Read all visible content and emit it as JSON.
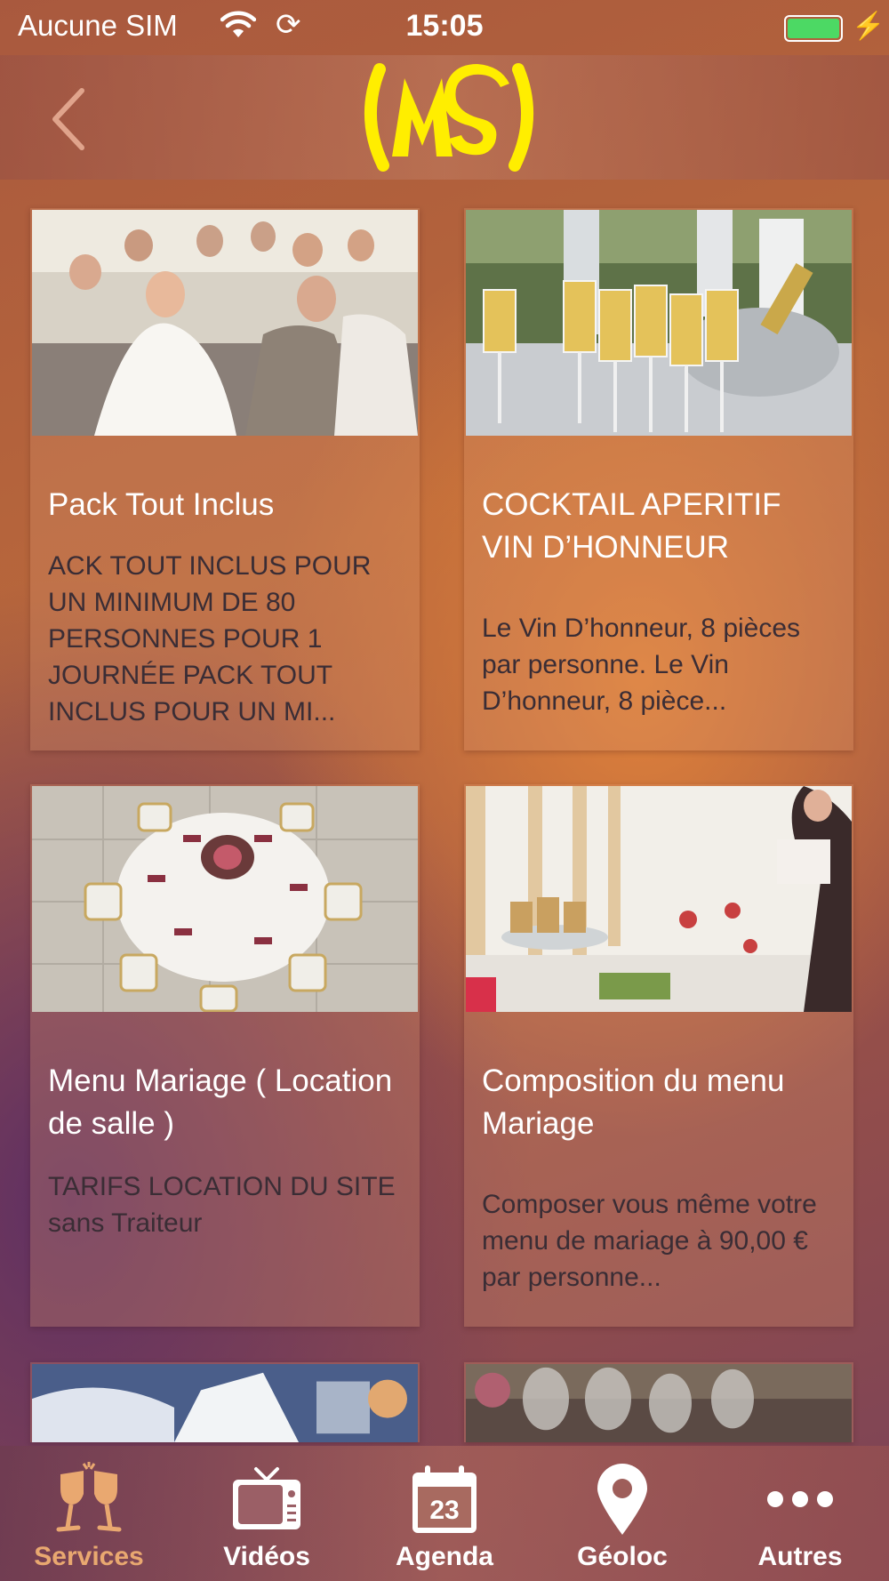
{
  "status_bar": {
    "carrier": "Aucune SIM",
    "time": "15:05",
    "icons": [
      "wifi-icon",
      "sync-icon",
      "battery-icon",
      "charging-icon"
    ]
  },
  "nav": {
    "back_icon": "chevron-left-icon",
    "logo_text": "MS",
    "logo_color": "#ffee00"
  },
  "cards": [
    {
      "title": "Pack Tout Inclus",
      "description": "ACK TOUT INCLUS POUR UN MINIMUM DE 80 PERSONNES POUR 1 JOURNÉE PACK TOUT INCLUS POUR UN MI...",
      "image": "wedding-party-photo"
    },
    {
      "title": "COCKTAIL APERITIF VIN D’HONNEUR",
      "description": "Le Vin D’honneur, 8 pièces par personne. Le Vin D’honneur, 8 pièce...",
      "image": "champagne-glasses-photo"
    },
    {
      "title": "Menu Mariage ( Location de salle )",
      "description": "TARIFS LOCATION DU SITE  sans Traiteur",
      "image": "round-banquet-table-photo"
    },
    {
      "title": "Composition du menu Mariage",
      "description": "Composer vous même votre menu de mariage à 90,00 € par personne...",
      "image": "buffet-desserts-photo"
    }
  ],
  "partial_cards": [
    {
      "image": "table-setting-photo"
    },
    {
      "image": "wine-glasses-photo"
    }
  ],
  "tabs": [
    {
      "label": "Services",
      "icon": "cheers-glasses-icon",
      "active": true
    },
    {
      "label": "Vidéos",
      "icon": "tv-icon",
      "active": false
    },
    {
      "label": "Agenda",
      "icon": "calendar-icon",
      "calendar_day": "23",
      "active": false
    },
    {
      "label": "Géoloc",
      "icon": "map-pin-icon",
      "active": false
    },
    {
      "label": "Autres",
      "icon": "more-dots-icon",
      "active": false
    }
  ],
  "colors": {
    "active_tab": "#e9a870",
    "card_title": "#ffffff",
    "card_description": "#3a2d35",
    "battery": "#4cd964"
  }
}
